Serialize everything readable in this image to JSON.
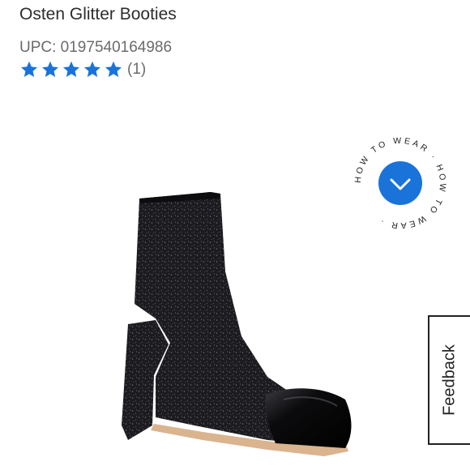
{
  "product": {
    "title": "Osten Glitter Booties",
    "upc": "UPC: 0197540164986",
    "rating": 5,
    "rating_max": 5,
    "review_count": "(1)"
  },
  "how_to_wear": {
    "label": "HOW TO WEAR · HOW TO WEAR ·",
    "icon": "chevron-down-icon"
  },
  "feedback": {
    "label": "Feedback"
  },
  "colors": {
    "star": "#1a73d9",
    "badge": "#1a73d9",
    "boot_body": "#1c1c20",
    "boot_toe": "#0b0b0d",
    "sole": "#d9b48e"
  }
}
